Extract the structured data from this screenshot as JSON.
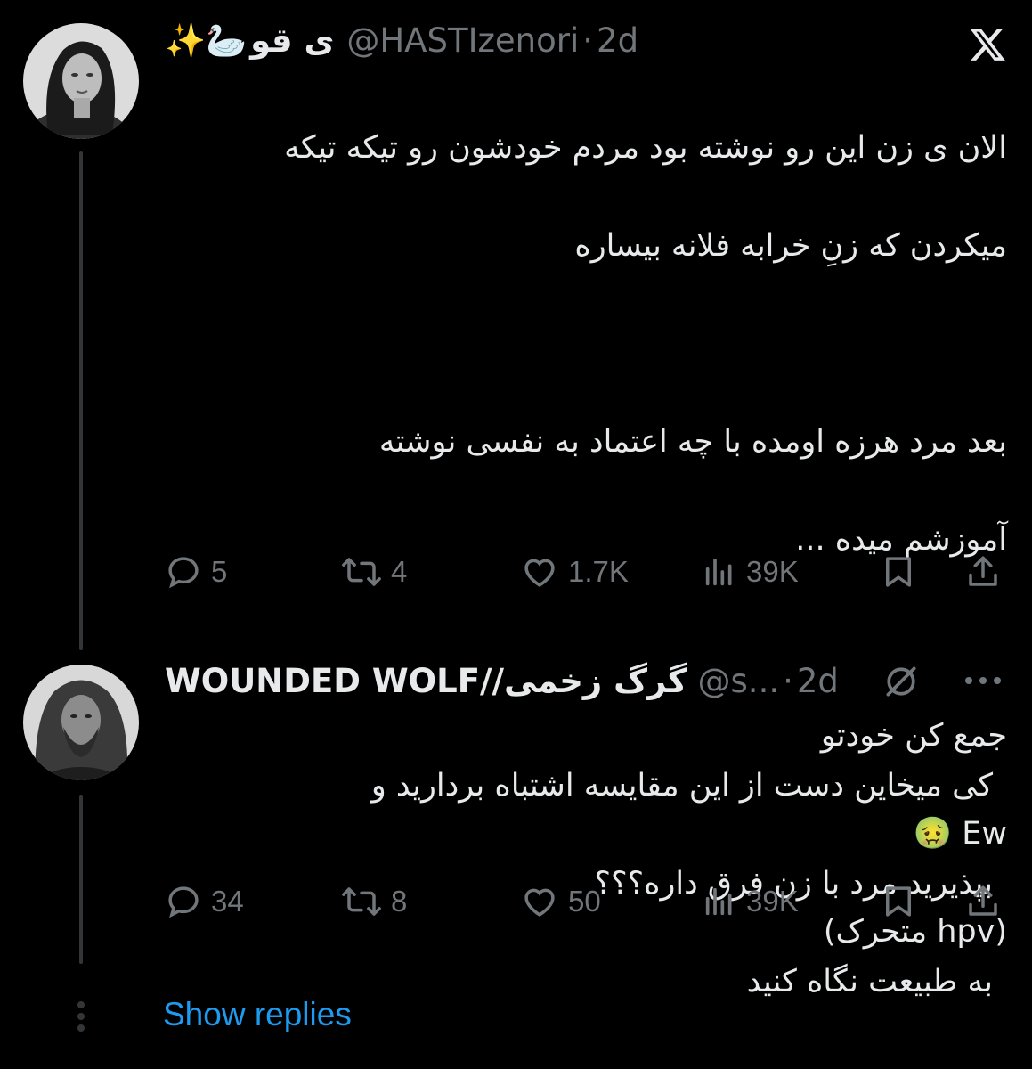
{
  "tweet1": {
    "display_name_emoji": "✨🦢",
    "display_name": "ی قو",
    "display_name_emoji_end": "✨",
    "handle": "@HASTIzenori",
    "dot": "·",
    "time": "2d",
    "lines": [
      "الان ی زن این رو نوشته بود مردم خودشون رو تیکه تیکه",
      "میکردن که زنِ خرابه فلانه بیساره",
      "",
      "بعد مرد هرزه اومده با چه اعتماد به نفسی نوشته",
      "آموزشم میده ...",
      "",
      "جمع کن خودتو",
      "Ew 🤢",
      "(hpv  متحرک)"
    ],
    "replies": "5",
    "retweets": "4",
    "likes": "1.7K",
    "views": "39K"
  },
  "tweet2": {
    "display_name": "WOUNDED WOLF//گرگ زخمی",
    "handle": "@s...",
    "dot": "·",
    "time": "2d",
    "lines": [
      "کی میخاین دست از این مقایسه اشتباه بردارید و",
      "بپذیرید مرد با زن فرق داره؟؟؟",
      "به طبیعت نگاه کنید"
    ],
    "replies": "34",
    "retweets": "8",
    "likes": "50",
    "views": "39K"
  },
  "show_replies": "Show replies",
  "colors": {
    "accent": "#1d9bf0",
    "muted": "#71767b",
    "text": "#e7e9ea",
    "background": "#000000"
  },
  "icons": [
    "x-logo-icon",
    "reply-icon",
    "retweet-icon",
    "like-icon",
    "views-icon",
    "bookmark-icon",
    "share-icon",
    "muted-slash-icon",
    "more-icon"
  ]
}
